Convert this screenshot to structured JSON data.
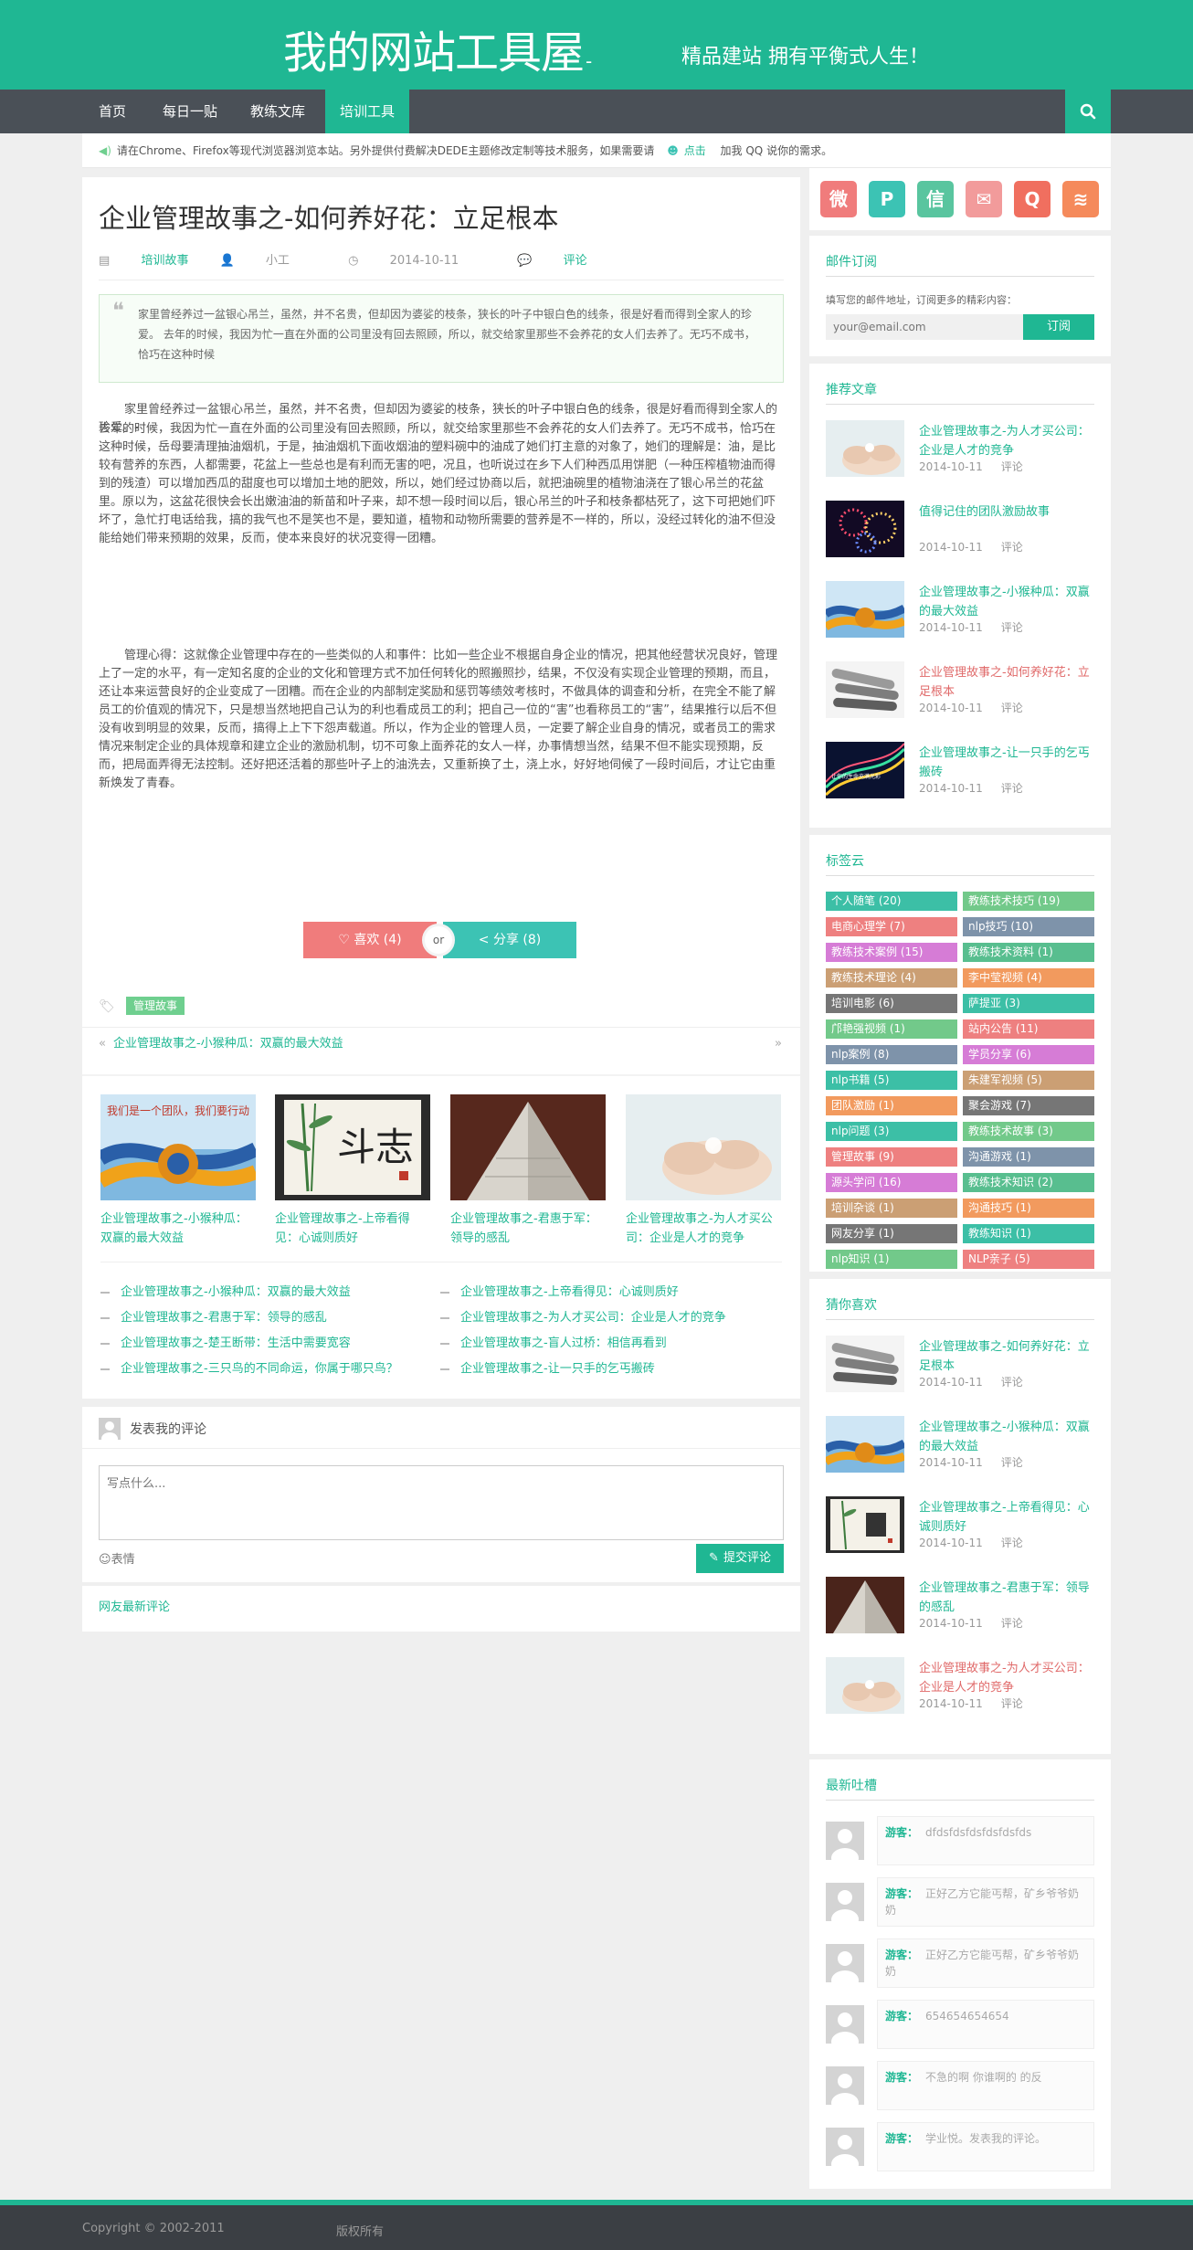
{
  "header": {
    "logo": "我的网站工具屋",
    "logo_dash": "-",
    "slogan": "精品建站 拥有平衡式人生！"
  },
  "nav": {
    "items": [
      "首页",
      "每日一贴",
      "教练文库",
      "培训工具"
    ],
    "active_index": 3
  },
  "notice": {
    "text": "请在Chrome、Firefox等现代浏览器浏览本站。另外提供付费解决DEDE主题修改定制等技术服务，如果需要请",
    "link": "点击",
    "tail": "加我 QQ 说你的需求。"
  },
  "article": {
    "title": "企业管理故事之-如何养好花：立足根本",
    "category": "培训故事",
    "author": "小工",
    "date": "2014-10-11",
    "comment_label": "评论",
    "quote": "家里曾经养过一盆银心吊兰，虽然，并不名贵，但却因为婆娑的枝条，狭长的叶子中银白色的线条，很是好看而得到全家人的珍爱。 去年的时候，我因为忙一直在外面的公司里没有回去照顾，所以，就交给家里那些不会养花的女人们去养了。无巧不成书，恰巧在这种时候",
    "para1": "家里曾经养过一盆银心吊兰，虽然，并不名贵，但却因为婆娑的枝条，狭长的叶子中银白色的线条，很是好看而得到全家人的珍爱。-",
    "para2": "去年的时候，我因为忙一直在外面的公司里没有回去照顾，所以，就交给家里那些不会养花的女人们去养了。无巧不成书，恰巧在这种时候，岳母要清理抽油烟机，于是，抽油烟机下面收烟油的塑料碗中的油成了她们打主意的对象了，她们的理解是：油，是比较有营养的东西，人都需要，花盆上一些总也是有利而无害的吧，况且，也听说过在乡下人们种西瓜用饼肥（一种压榨植物油而得到的残渣）可以增加西瓜的甜度也可以增加土地的肥效，所以，她们经过协商以后，就把油碗里的植物油浇在了银心吊兰的花盆里。原以为，这盆花很快会长出嫩油油的新苗和叶子来，却不想一段时间以后，银心吊兰的叶子和枝条都枯死了，这下可把她们吓坏了，急忙打电话给我，搞的我气也不是笑也不是，要知道，植物和动物所需要的营养是不一样的，所以，没经过转化的油不但没能给她们带来预期的效果，反而，使本来良好的状况变得一团糟。",
    "para3": "管理心得：这就像企业管理中存在的一些类似的人和事件：比如一些企业不根据自身企业的情况，把其他经营状况良好，管理上了一定的水平，有一定知名度的企业的文化和管理方式不加任何转化的照搬照抄，结果，不仅没有实现企业管理的预期，而且，还让本来运营良好的企业变成了一团糟。而在企业的内部制定奖励和惩罚等绩效考核时，不做具体的调查和分析，在完全不能了解员工的价值观的情况下，只是想当然地把自己认为的利也看成员工的利；把自己一位的“害”也看称员工的“害”，结果推行以后不但没有收到明显的效果，反而，搞得上上下下怨声载道。所以，作为企业的管理人员，一定要了解企业自身的情况，或者员工的需求情况来制定企业的具体规章和建立企业的激励机制，切不可象上面养花的女人一样，办事情想当然，结果不但不能实现预期，反而，把局面弄得无法控制。还好把还活着的那些叶子上的油洗去，又重新换了土，浇上水，好好地伺候了一段时间后，才让它由重新焕发了青春。",
    "like_label": "喜欢 (4)",
    "or_label": "or",
    "share_label": "分享 (8)",
    "tag": "管理故事",
    "prev": "企业管理故事之-小猴种瓜：双赢的最大效益",
    "prev_arrow": "«",
    "next_arrow": "»"
  },
  "related": [
    {
      "title": "企业管理故事之-小猴种瓜：双赢的最大效益"
    },
    {
      "title": "企业管理故事之-上帝看得见：心诚则质好"
    },
    {
      "title": "企业管理故事之-君惠于军：领导的感乱"
    },
    {
      "title": "企业管理故事之-为人才买公司：企业是人才的竞争"
    }
  ],
  "link_list": [
    "企业管理故事之-小猴种瓜：双赢的最大效益",
    "企业管理故事之-上帝看得见：心诚则质好",
    "企业管理故事之-君惠于军：领导的感乱",
    "企业管理故事之-为人才买公司：企业是人才的竞争",
    "企业管理故事之-楚王断带：生活中需要宽容",
    "企业管理故事之-盲人过桥：相信再看到",
    "企业管理故事之-三只鸟的不同命运，你属于哪只鸟？",
    "企业管理故事之-让一只手的乞丐搬砖"
  ],
  "comment_form": {
    "title": "发表我的评论",
    "placeholder": "写点什么...",
    "emoji": "表情",
    "submit": "提交评论",
    "latest_label": "网友最新评论"
  },
  "sidebar": {
    "social_icons": [
      {
        "name": "weibo-icon",
        "color": "#f07c7c",
        "glyph": "微"
      },
      {
        "name": "tencent-weibo-icon",
        "color": "#3cc3b4",
        "glyph": "P"
      },
      {
        "name": "wechat-icon",
        "color": "#59c59f",
        "glyph": "信"
      },
      {
        "name": "email-icon",
        "color": "#f29b9b",
        "glyph": "✉"
      },
      {
        "name": "qq-icon",
        "color": "#f06f5f",
        "glyph": "Q"
      },
      {
        "name": "rss-icon",
        "color": "#f58a5b",
        "glyph": "≋"
      }
    ],
    "subscribe": {
      "title": "邮件订阅",
      "desc": "填写您的邮件地址，订阅更多的精彩内容：",
      "placeholder": "your@email.com",
      "button": "订阅"
    },
    "recommended": {
      "title": "推荐文章",
      "posts": [
        {
          "title": "企业管理故事之-为人才买公司：企业是人才的竞争",
          "date": "2014-10-11",
          "comments": "评论",
          "red": false,
          "thumb": "hands"
        },
        {
          "title": "值得记住的团队激励故事",
          "date": "2014-10-11",
          "comments": "评论",
          "red": false,
          "thumb": "fireworks"
        },
        {
          "title": "企业管理故事之-小猴种瓜：双赢的最大效益",
          "date": "2014-10-11",
          "comments": "评论",
          "red": false,
          "thumb": "rope"
        },
        {
          "title": "企业管理故事之-如何养好花：立足根本",
          "date": "2014-10-11",
          "comments": "评论",
          "red": true,
          "thumb": "scrolls"
        },
        {
          "title": "企业管理故事之-让一只手的乞丐搬砖",
          "date": "2014-10-11",
          "comments": "评论",
          "red": false,
          "thumb": "lights"
        }
      ],
      "lights_caption": "让你的生命充满光彩"
    },
    "tag_cloud": {
      "title": "标签云",
      "tags": [
        {
          "label": "个人随笔 (20)",
          "color": "#3cbfa6"
        },
        {
          "label": "教练技术技巧 (19)",
          "color": "#72c98a"
        },
        {
          "label": "电商心理学 (7)",
          "color": "#ee8080"
        },
        {
          "label": "nlp技巧 (10)",
          "color": "#7e93aa"
        },
        {
          "label": "教练技术案例 (15)",
          "color": "#d67cd6"
        },
        {
          "label": "教练技术资料 (1)",
          "color": "#58be8f"
        },
        {
          "label": "教练技术理论 (4)",
          "color": "#cb9f74"
        },
        {
          "label": "李中莹视频 (4)",
          "color": "#f29a5e"
        },
        {
          "label": "培训电影 (6)",
          "color": "#767676"
        },
        {
          "label": "萨提亚 (3)",
          "color": "#3cbfa6"
        },
        {
          "label": "邝艳强视频 (1)",
          "color": "#72c98a"
        },
        {
          "label": "站内公告 (11)",
          "color": "#ee8080"
        },
        {
          "label": "nlp案例 (8)",
          "color": "#7e93aa"
        },
        {
          "label": "学员分享 (6)",
          "color": "#d67cd6"
        },
        {
          "label": "nlp书籍 (5)",
          "color": "#3cbfa6"
        },
        {
          "label": "朱建军视频 (5)",
          "color": "#cb9f74"
        },
        {
          "label": "团队激励 (1)",
          "color": "#f29a5e"
        },
        {
          "label": "聚会游戏 (7)",
          "color": "#767676"
        },
        {
          "label": "nlp问题 (3)",
          "color": "#3cbfa6"
        },
        {
          "label": "教练技术故事 (3)",
          "color": "#72c98a"
        },
        {
          "label": "管理故事 (9)",
          "color": "#ee8080"
        },
        {
          "label": "沟通游戏 (1)",
          "color": "#7e93aa"
        },
        {
          "label": "源头学问 (16)",
          "color": "#d67cd6"
        },
        {
          "label": "教练技术知识 (2)",
          "color": "#58be8f"
        },
        {
          "label": "培训杂谈 (1)",
          "color": "#cb9f74"
        },
        {
          "label": "沟通技巧 (1)",
          "color": "#f29a5e"
        },
        {
          "label": "网友分享 (1)",
          "color": "#767676"
        },
        {
          "label": "教练知识 (1)",
          "color": "#3cbfa6"
        },
        {
          "label": "nlp知识 (1)",
          "color": "#72c98a"
        },
        {
          "label": "NLP亲子 (5)",
          "color": "#ee8080"
        }
      ]
    },
    "guess": {
      "title": "猜你喜欢",
      "posts": [
        {
          "title": "企业管理故事之-如何养好花：立足根本",
          "date": "2014-10-11",
          "comments": "评论",
          "red": false,
          "thumb": "scrolls"
        },
        {
          "title": "企业管理故事之-小猴种瓜：双赢的最大效益",
          "date": "2014-10-11",
          "comments": "评论",
          "red": false,
          "thumb": "rope"
        },
        {
          "title": "企业管理故事之-上帝看得见：心诚则质好",
          "date": "2014-10-11",
          "comments": "评论",
          "red": false,
          "thumb": "bamboo"
        },
        {
          "title": "企业管理故事之-君惠于军：领导的感乱",
          "date": "2014-10-11",
          "comments": "评论",
          "red": false,
          "thumb": "pyramid"
        },
        {
          "title": "企业管理故事之-为人才买公司：企业是人才的竞争",
          "date": "2014-10-11",
          "comments": "评论",
          "red": true,
          "thumb": "hands"
        }
      ]
    },
    "latest_comments": {
      "title": "最新吐槽",
      "items": [
        {
          "name": "游客：",
          "text": "dfdsfdsfdsfdsfdsfds"
        },
        {
          "name": "游客：",
          "text": "正好乙方它能丐帮，矿乡爷爷奶奶"
        },
        {
          "name": "游客：",
          "text": "正好乙方它能丐帮，矿乡爷爷奶奶"
        },
        {
          "name": "游客：",
          "text": "654654654654"
        },
        {
          "name": "游客：",
          "text": "不急的啊 你谁啊的 的反"
        },
        {
          "name": "游客：",
          "text": "学业悦。发表我的评论。"
        }
      ]
    }
  },
  "footer": {
    "copyright": "Copyright © 2002-2011",
    "rights": "版权所有"
  },
  "colors": {
    "accent": "#1fb793",
    "nav_bg": "#4a5057",
    "footer_bg": "#3b3f44"
  },
  "images": {
    "rope_text": "我们是一个团队，我们要行动",
    "bamboo_text": "斗志"
  }
}
